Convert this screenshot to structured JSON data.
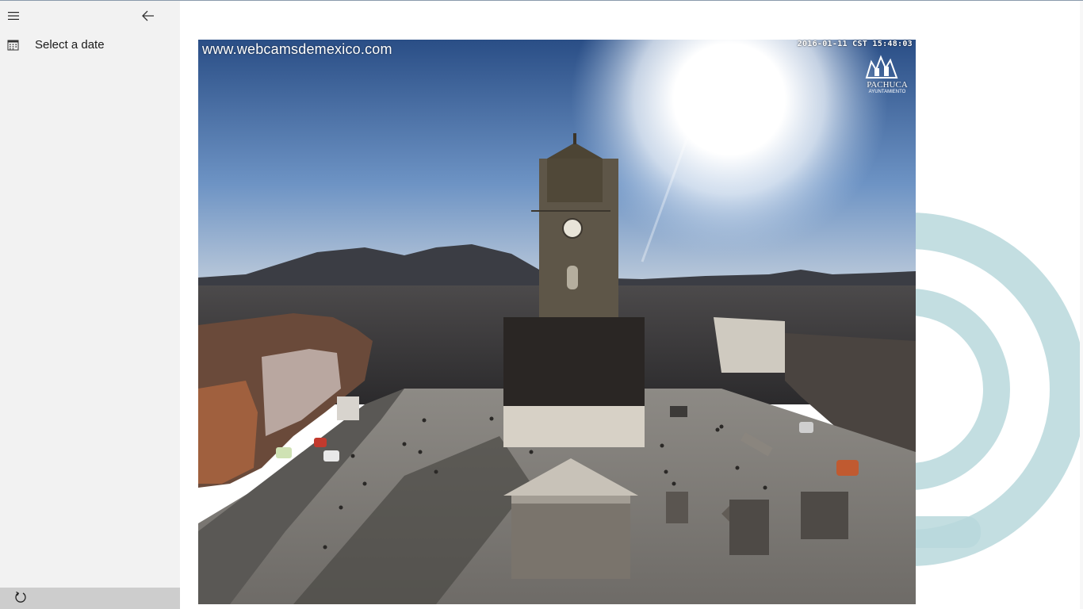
{
  "sidebar": {
    "menu_icon": "hamburger-icon",
    "back_icon": "back-arrow-icon",
    "items": [
      {
        "label": "Select a date",
        "icon": "calendar-icon"
      }
    ],
    "footer": {
      "refresh_icon": "refresh-icon"
    }
  },
  "webcam": {
    "watermark_url": "www.webcamsdemexico.com",
    "timestamp": "2016-01-11 CST 15:48:03",
    "logo_name": "PACHUCA",
    "logo_sub": "AYUNTAMIENTO"
  },
  "colors": {
    "sidebar_bg": "#f2f2f2",
    "bottom_bar_bg": "#cdcdcd",
    "watermark": "#b9d8dc"
  }
}
